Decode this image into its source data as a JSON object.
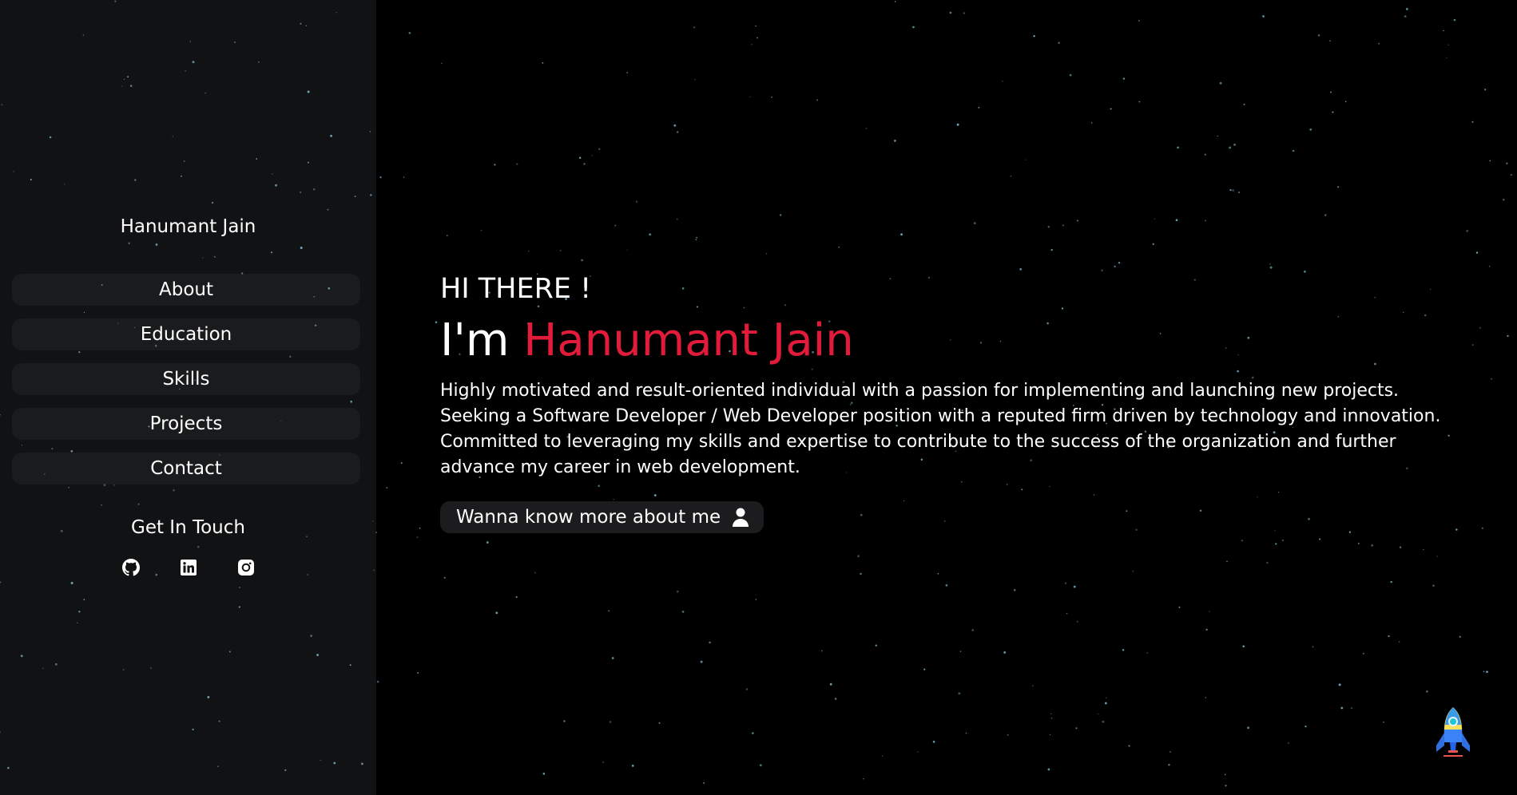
{
  "sidebar": {
    "brand": "Hanumant Jain",
    "nav_items": [
      {
        "label": "About"
      },
      {
        "label": "Education"
      },
      {
        "label": "Skills"
      },
      {
        "label": "Projects"
      },
      {
        "label": "Contact"
      }
    ],
    "get_in_touch": "Get In Touch",
    "social_icons": [
      "github-icon",
      "linkedin-icon",
      "instagram-icon"
    ]
  },
  "hero": {
    "greeting": "HI THERE !",
    "name_prefix": "I'm",
    "name": "Hanumant Jain",
    "bio": "Highly motivated and result-oriented individual with a passion for implementing and launching new projects. Seeking a Software Developer / Web Developer position with a reputed firm driven by technology and innovation. Committed to leveraging my skills and expertise to contribute to the success of the organization and further advance my career in web development.",
    "cta_label": "Wanna know more about me",
    "cta_icon": "user-icon"
  },
  "scroll_top_icon": "rocket-icon",
  "colors": {
    "background": "#000000",
    "sidebar": "#111213",
    "nav_item": "#1a1b1c",
    "accent": "#e31b3b",
    "text": "#ffffff",
    "star": "#7fb3c8"
  }
}
